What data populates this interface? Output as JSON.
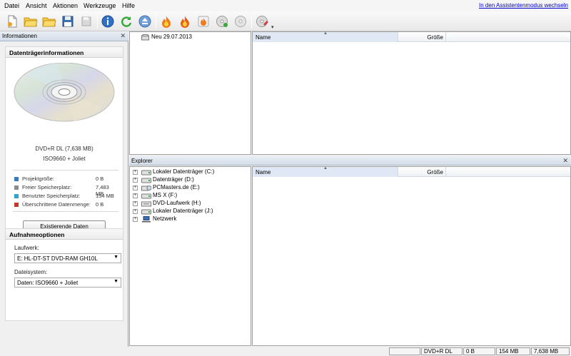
{
  "menu": {
    "items": [
      {
        "label": "Datei"
      },
      {
        "label": "Ansicht"
      },
      {
        "label": "Aktionen"
      },
      {
        "label": "Werkzeuge"
      },
      {
        "label": "Hilfe"
      }
    ],
    "assistant_link": "In den Assistentenmodus wechseln"
  },
  "toolbar": {
    "buttons": [
      "new-project-icon",
      "open-icon",
      "open-folder-icon",
      "save-icon",
      "save-as-icon",
      "info-icon",
      "refresh-icon",
      "eject-icon",
      "burn-icon",
      "burn-image-icon",
      "burn-settings-icon",
      "copy-disc-icon",
      "disc-icon",
      "erase-disc-icon"
    ]
  },
  "info_panel": {
    "title": "Informationen",
    "section_title": "Datenträgerinformationen",
    "disc_type": "DVD+R DL (7,638 MB)",
    "file_system": "ISO9660 + Joliet",
    "stats": [
      {
        "label": "Projektgröße:",
        "value": "0 B",
        "color": "#3a7bbf"
      },
      {
        "label": "Freier Speicherplatz:",
        "value": "7,483 MB",
        "color": "#8a8a8a"
      },
      {
        "label": "Benutzter Speicherplatz:",
        "value": "154 MB",
        "color": "#2fa4c8"
      },
      {
        "label": "Überschrittene Datenmenge:",
        "value": "0 B",
        "color": "#c0392b"
      }
    ],
    "take_over_button": "Existierende Daten übernehmen"
  },
  "recording": {
    "title": "Aufnahmeoptionen",
    "drive_label": "Laufwerk:",
    "drive_value": "E: HL-DT-ST DVD-RAM GH10L",
    "fs_label": "Dateisystem:",
    "fs_value": "Daten: ISO9660 + Joliet"
  },
  "project": {
    "node": "Neu 29.07.2013",
    "columns": {
      "name": "Name",
      "size": "Größe"
    }
  },
  "explorer": {
    "title": "Explorer",
    "tree": [
      {
        "label": "Lokaler Datenträger (C:)",
        "icon": "hard-drive-icon"
      },
      {
        "label": "Datenträger (D:)",
        "icon": "hard-drive-icon"
      },
      {
        "label": "PCMasters.de (E:)",
        "icon": "optical-drive-icon"
      },
      {
        "label": "MS X (F:)",
        "icon": "hard-drive-icon"
      },
      {
        "label": "DVD-Laufwerk (H:)",
        "icon": "dvd-drive-icon"
      },
      {
        "label": "Lokaler Datenträger (J:)",
        "icon": "hard-drive-icon"
      },
      {
        "label": "Netzwerk",
        "icon": "network-icon"
      }
    ],
    "columns": {
      "name": "Name",
      "size": "Größe"
    }
  },
  "status": {
    "cells": [
      "",
      "DVD+R DL",
      "0 B",
      "154 MB",
      "7,638 MB"
    ]
  }
}
